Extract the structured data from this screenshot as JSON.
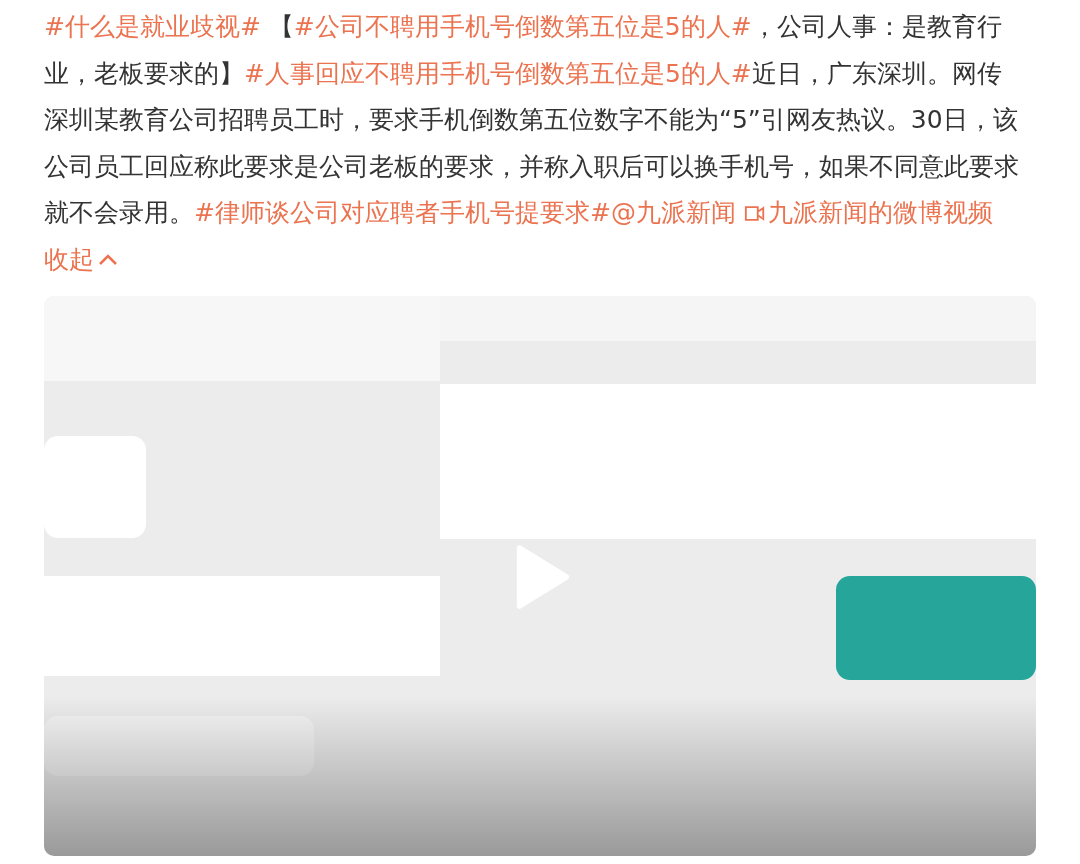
{
  "post": {
    "segments": [
      {
        "kind": "hashtag",
        "text": "#什么是就业歧视#"
      },
      {
        "kind": "text",
        "text": " 【"
      },
      {
        "kind": "hashtag",
        "text": "#公司不聘用手机号倒数第五位是5的人#"
      },
      {
        "kind": "text",
        "text": "，公司人事：是教育行业，老板要求的】"
      },
      {
        "kind": "hashtag",
        "text": "#人事回应不聘用手机号倒数第五位是5的人#"
      },
      {
        "kind": "text",
        "text": "近日，广东深圳。网传深圳某教育公司招聘员工时，要求手机倒数第五位数字不能为“5”引网友热议。30日，该公司员工回应称此要求是公司老板的要求，并称入职后可以换手机号，如果不同意此要求就不会录用。"
      },
      {
        "kind": "hashtag",
        "text": "#律师谈公司对应聘者手机号提要求#"
      },
      {
        "kind": "mention",
        "text": "@九派新闻"
      },
      {
        "kind": "video_link",
        "text": "九派新闻的微博视频"
      }
    ],
    "collapse_link": "收起"
  }
}
